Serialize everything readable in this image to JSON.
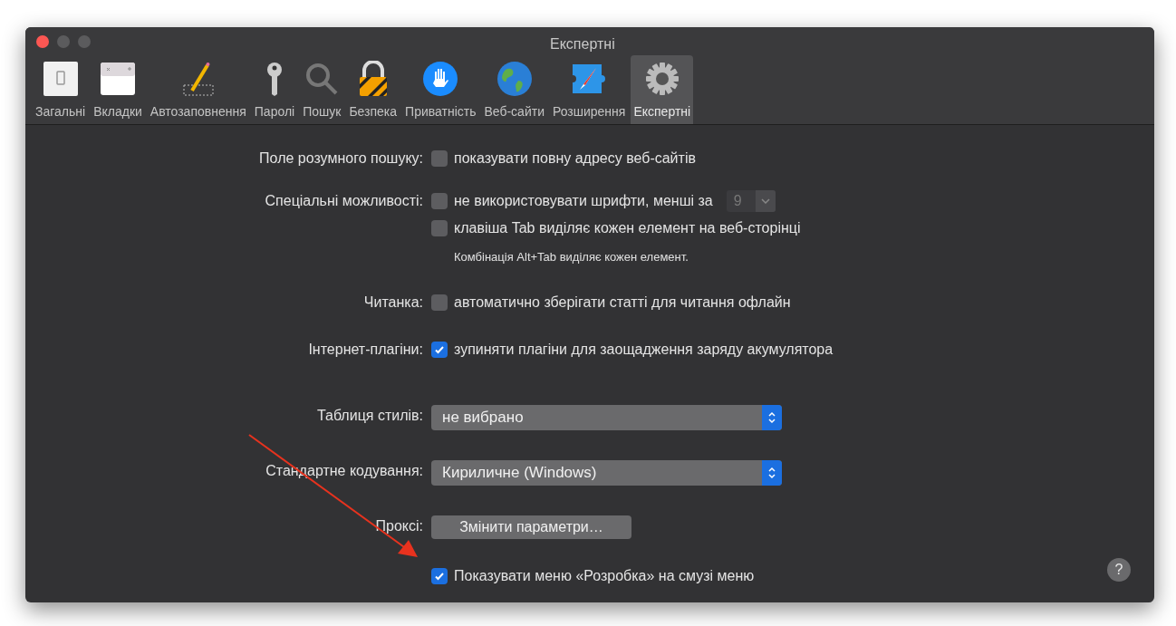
{
  "window": {
    "title": "Експертні"
  },
  "toolbar": [
    {
      "label": "Загальні",
      "selected": false
    },
    {
      "label": "Вкладки",
      "selected": false
    },
    {
      "label": "Автозаповнення",
      "selected": false
    },
    {
      "label": "Паролі",
      "selected": false
    },
    {
      "label": "Пошук",
      "selected": false
    },
    {
      "label": "Безпека",
      "selected": false
    },
    {
      "label": "Приватність",
      "selected": false
    },
    {
      "label": "Веб-сайти",
      "selected": false
    },
    {
      "label": "Розширення",
      "selected": false
    },
    {
      "label": "Експертні",
      "selected": true
    }
  ],
  "settings": [
    {
      "label": "Поле розумного пошуку:",
      "items": [
        {
          "kind": "checkbox",
          "text": "показувати повну адресу веб-сайтів",
          "checked": false
        }
      ]
    },
    {
      "label": "Спеціальні можливості:",
      "items": [
        {
          "kind": "checkbox_number",
          "text": "не використовувати шрифти, менші за",
          "checked": false,
          "value": "9"
        },
        {
          "kind": "checkbox",
          "text": "клавіша Tab виділяє кожен елемент на веб-сторінці",
          "checked": false
        },
        {
          "kind": "note",
          "text": "Комбінація Alt+Tab виділяє кожен елемент."
        }
      ]
    },
    {
      "label": "Читанка:",
      "items": [
        {
          "kind": "checkbox",
          "text": "автоматично зберігати статті для читання офлайн",
          "checked": false
        }
      ]
    },
    {
      "label": "Інтернет-плагіни:",
      "items": [
        {
          "kind": "checkbox",
          "text": "зупиняти плагіни для заощадження заряду акумулятора",
          "checked": true
        }
      ]
    },
    {
      "label": "Таблиця стилів:",
      "items": [
        {
          "kind": "select",
          "value": "не вибрано"
        }
      ]
    },
    {
      "label": "Стандартне кодування:",
      "items": [
        {
          "kind": "select",
          "value": "Кириличне (Windows)"
        }
      ]
    },
    {
      "label": "Проксі:",
      "items": [
        {
          "kind": "button",
          "text": "Змінити параметри…"
        }
      ]
    },
    {
      "items": [
        {
          "kind": "checkbox",
          "text": "Показувати меню «Розробка» на смузі меню",
          "checked": true
        }
      ]
    }
  ],
  "help_button": "?"
}
